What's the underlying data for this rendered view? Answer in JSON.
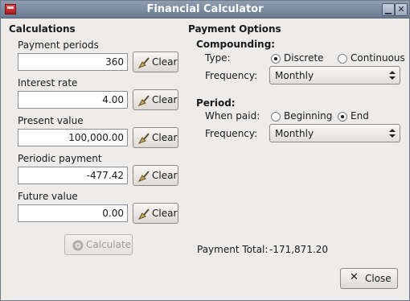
{
  "window": {
    "title": "Financial Calculator",
    "app_icon": "calculator-icon",
    "minimize_symbol": "▁",
    "close_symbol": "✕"
  },
  "calculations": {
    "heading": "Calculations",
    "fields": [
      {
        "label": "Payment periods",
        "value": "360"
      },
      {
        "label": "Interest rate",
        "value": "4.00"
      },
      {
        "label": "Present value",
        "value": "100,000.00"
      },
      {
        "label": "Periodic payment",
        "value": "-477.42"
      },
      {
        "label": "Future value",
        "value": "0.00"
      }
    ],
    "clear_label": "Clear",
    "clear_icon": "broom-icon",
    "calculate_label": "Calculate",
    "calculate_icon": "gear-icon"
  },
  "payment_options": {
    "heading": "Payment Options",
    "compounding": {
      "heading": "Compounding:",
      "type_label": "Type:",
      "type_options": [
        "Discrete",
        "Continuous"
      ],
      "type_selected": "Discrete",
      "frequency_label": "Frequency:",
      "frequency_value": "Monthly"
    },
    "period": {
      "heading": "Period:",
      "when_paid_label": "When paid:",
      "when_paid_options": [
        "Beginning",
        "End"
      ],
      "when_paid_selected": "End",
      "frequency_label": "Frequency:",
      "frequency_value": "Monthly"
    }
  },
  "payment_total": {
    "label": "Payment Total:",
    "value": "-171,871.20"
  },
  "close_button": {
    "label": "Close",
    "icon": "close-icon"
  },
  "colors": {
    "titlebar": "#7b8aa0",
    "window_bg": "#edeceb",
    "entry_bg": "#ffffff"
  }
}
